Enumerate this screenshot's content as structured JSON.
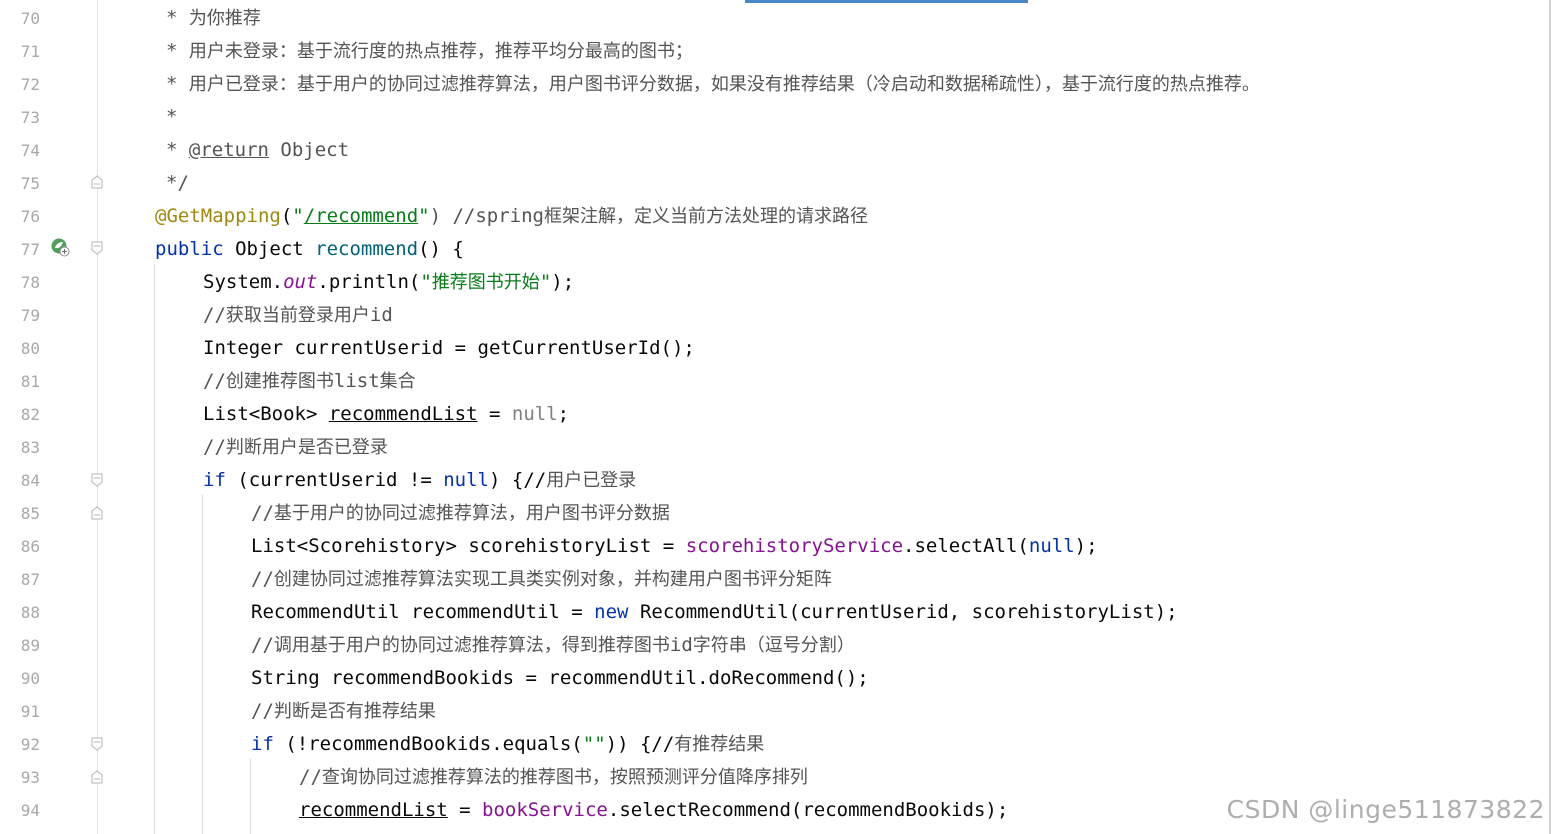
{
  "editor": {
    "lines": [
      {
        "n": "70",
        "parts": [
          {
            "t": "* ",
            "c": "doc"
          },
          {
            "t": "为你推荐",
            "c": "doc cjk"
          }
        ]
      },
      {
        "n": "71",
        "parts": [
          {
            "t": "* ",
            "c": "doc"
          },
          {
            "t": "用户未登录：基于流行度的热点推荐，推荐平均分最高的图书；",
            "c": "doc cjk"
          }
        ]
      },
      {
        "n": "72",
        "parts": [
          {
            "t": "* ",
            "c": "doc"
          },
          {
            "t": "用户已登录：基于用户的协同过滤推荐算法，用户图书评分数据，如果没有推荐结果（冷启动和数据稀疏性），基于流行度的热点推荐。",
            "c": "doc cjk"
          }
        ]
      },
      {
        "n": "73",
        "parts": [
          {
            "t": "*",
            "c": "doc"
          }
        ]
      },
      {
        "n": "74",
        "parts": [
          {
            "t": "* ",
            "c": "doc"
          },
          {
            "t": "@return",
            "c": "doc-tag"
          },
          {
            "t": " Object",
            "c": "doc"
          }
        ]
      },
      {
        "n": "75",
        "parts": [
          {
            "t": "*/",
            "c": "doc"
          }
        ]
      },
      {
        "n": "76",
        "parts": [
          {
            "t": "@GetMapping",
            "c": "ann"
          },
          {
            "t": "(",
            "c": ""
          },
          {
            "t": "\"",
            "c": "str"
          },
          {
            "t": "/recommend",
            "c": "str ul"
          },
          {
            "t": "\"",
            "c": "str"
          },
          {
            "t": ") //spring",
            "c": "comment"
          },
          {
            "t": "框架注解，定义当前方法处理的请求路径",
            "c": "comment cjk"
          }
        ]
      },
      {
        "n": "77",
        "parts": [
          {
            "t": "public",
            "c": "kw"
          },
          {
            "t": " Object ",
            "c": ""
          },
          {
            "t": "recommend",
            "c": "method-decl"
          },
          {
            "t": "() {",
            "c": ""
          }
        ]
      },
      {
        "n": "78",
        "parts": [
          {
            "t": "System.",
            "c": ""
          },
          {
            "t": "out",
            "c": "static"
          },
          {
            "t": ".println(",
            "c": ""
          },
          {
            "t": "\"",
            "c": "str"
          },
          {
            "t": "推荐图书开始",
            "c": "str cjk"
          },
          {
            "t": "\"",
            "c": "str"
          },
          {
            "t": ");",
            "c": ""
          }
        ]
      },
      {
        "n": "79",
        "parts": [
          {
            "t": "//",
            "c": "comment"
          },
          {
            "t": "获取当前登录用户",
            "c": "comment cjk"
          },
          {
            "t": "id",
            "c": "comment"
          }
        ]
      },
      {
        "n": "80",
        "parts": [
          {
            "t": "Integer currentUserid = getCurrentUserId();",
            "c": ""
          }
        ]
      },
      {
        "n": "81",
        "parts": [
          {
            "t": "//",
            "c": "comment"
          },
          {
            "t": "创建推荐图书",
            "c": "comment cjk"
          },
          {
            "t": "list",
            "c": "comment"
          },
          {
            "t": "集合",
            "c": "comment cjk"
          }
        ]
      },
      {
        "n": "82",
        "parts": [
          {
            "t": "List<Book> ",
            "c": ""
          },
          {
            "t": "recommendList",
            "c": "ul"
          },
          {
            "t": " = ",
            "c": ""
          },
          {
            "t": "null",
            "c": "null-gray"
          },
          {
            "t": ";",
            "c": ""
          }
        ]
      },
      {
        "n": "83",
        "parts": [
          {
            "t": "//",
            "c": "comment"
          },
          {
            "t": "判断用户是否已登录",
            "c": "comment cjk"
          }
        ]
      },
      {
        "n": "84",
        "parts": [
          {
            "t": "if",
            "c": "kw"
          },
          {
            "t": " (currentUserid != ",
            "c": ""
          },
          {
            "t": "null",
            "c": "null"
          },
          {
            "t": ") {//",
            "c": ""
          },
          {
            "t": "用户已登录",
            "c": "comment cjk"
          }
        ]
      },
      {
        "n": "85",
        "parts": [
          {
            "t": "//",
            "c": "comment"
          },
          {
            "t": "基于用户的协同过滤推荐算法，用户图书评分数据",
            "c": "comment cjk"
          }
        ]
      },
      {
        "n": "86",
        "parts": [
          {
            "t": "List<Scorehistory> scorehistoryList = ",
            "c": ""
          },
          {
            "t": "scorehistoryService",
            "c": "field"
          },
          {
            "t": ".selectAll(",
            "c": ""
          },
          {
            "t": "null",
            "c": "null"
          },
          {
            "t": ");",
            "c": ""
          }
        ]
      },
      {
        "n": "87",
        "parts": [
          {
            "t": "//",
            "c": "comment"
          },
          {
            "t": "创建协同过滤推荐算法实现工具类实例对象，并构建用户图书评分矩阵",
            "c": "comment cjk"
          }
        ]
      },
      {
        "n": "88",
        "parts": [
          {
            "t": "RecommendUtil recommendUtil = ",
            "c": ""
          },
          {
            "t": "new",
            "c": "kw"
          },
          {
            "t": " RecommendUtil(currentUserid, scorehistoryList);",
            "c": ""
          }
        ]
      },
      {
        "n": "89",
        "parts": [
          {
            "t": "//",
            "c": "comment"
          },
          {
            "t": "调用基于用户的协同过滤推荐算法，得到推荐图书",
            "c": "comment cjk"
          },
          {
            "t": "id",
            "c": "comment"
          },
          {
            "t": "字符串（逗号分割）",
            "c": "comment cjk"
          }
        ]
      },
      {
        "n": "90",
        "parts": [
          {
            "t": "String recommendBookids = recommendUtil.doRecommend();",
            "c": ""
          }
        ]
      },
      {
        "n": "91",
        "parts": [
          {
            "t": "//",
            "c": "comment"
          },
          {
            "t": "判断是否有推荐结果",
            "c": "comment cjk"
          }
        ]
      },
      {
        "n": "92",
        "parts": [
          {
            "t": "if",
            "c": "kw"
          },
          {
            "t": " (!recommendBookids.equals(",
            "c": ""
          },
          {
            "t": "\"\"",
            "c": "str"
          },
          {
            "t": ")) {//",
            "c": ""
          },
          {
            "t": "有推荐结果",
            "c": "comment cjk"
          }
        ]
      },
      {
        "n": "93",
        "parts": [
          {
            "t": "//",
            "c": "comment"
          },
          {
            "t": "查询协同过滤推荐算法的推荐图书，按照预测评分值降序排列",
            "c": "comment cjk"
          }
        ]
      },
      {
        "n": "94",
        "parts": [
          {
            "t": "recommendList",
            "c": "ul"
          },
          {
            "t": " = ",
            "c": ""
          },
          {
            "t": "bookService",
            "c": "field"
          },
          {
            "t": ".selectRecommend(recommendBookids);",
            "c": ""
          }
        ]
      }
    ]
  },
  "watermark": "CSDN @linge511873822"
}
